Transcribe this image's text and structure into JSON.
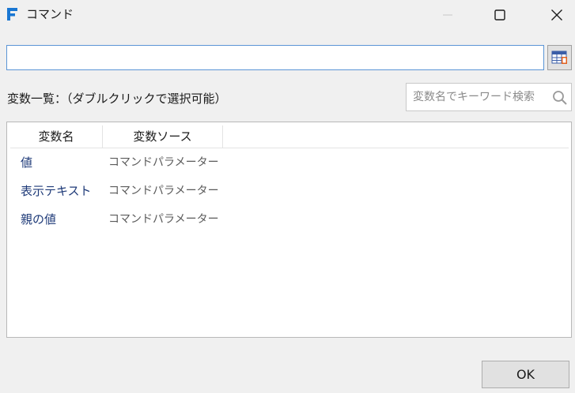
{
  "window": {
    "title": "コマンド",
    "app_icon": "f-logo-icon",
    "controls": {
      "minimize": "minimize-icon",
      "maximize": "maximize-icon",
      "close": "close-icon"
    }
  },
  "expression": {
    "value": "",
    "button_icon": "table-picker-icon"
  },
  "variables": {
    "label": "変数一覧：（ダブルクリックで選択可能）",
    "search_placeholder": "変数名でキーワード検索",
    "columns": [
      "変数名",
      "変数ソース"
    ],
    "rows": [
      {
        "name": "値",
        "source": "コマンドパラメーター"
      },
      {
        "name": "表示テキスト",
        "source": "コマンドパラメーター"
      },
      {
        "name": "親の値",
        "source": "コマンドパラメーター"
      }
    ]
  },
  "footer": {
    "ok_label": "OK"
  },
  "colors": {
    "accent_border": "#5b95d6",
    "variable_name": "#1e3a78",
    "app_icon": "#1976d2"
  }
}
